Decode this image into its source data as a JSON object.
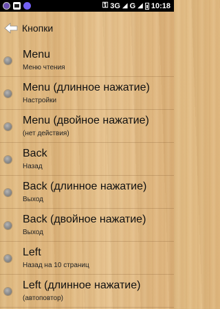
{
  "status_bar": {
    "network": "3G",
    "network_sup": "3G",
    "network2": "G",
    "time": "10:18"
  },
  "header": {
    "title": "Кнопки"
  },
  "items": [
    {
      "name": "Menu",
      "desc": "Меню чтения"
    },
    {
      "name": "Menu (длинное нажатие)",
      "desc": "Настройки"
    },
    {
      "name": "Menu (двойное нажатие)",
      "desc": "(нет действия)"
    },
    {
      "name": "Back",
      "desc": "Назад"
    },
    {
      "name": "Back (длинное нажатие)",
      "desc": "Выход"
    },
    {
      "name": "Back (двойное нажатие)",
      "desc": "Выход"
    },
    {
      "name": "Left",
      "desc": "Назад на 10 страниц"
    },
    {
      "name": "Left (длинное нажатие)",
      "desc": "(автоповтор)"
    }
  ]
}
